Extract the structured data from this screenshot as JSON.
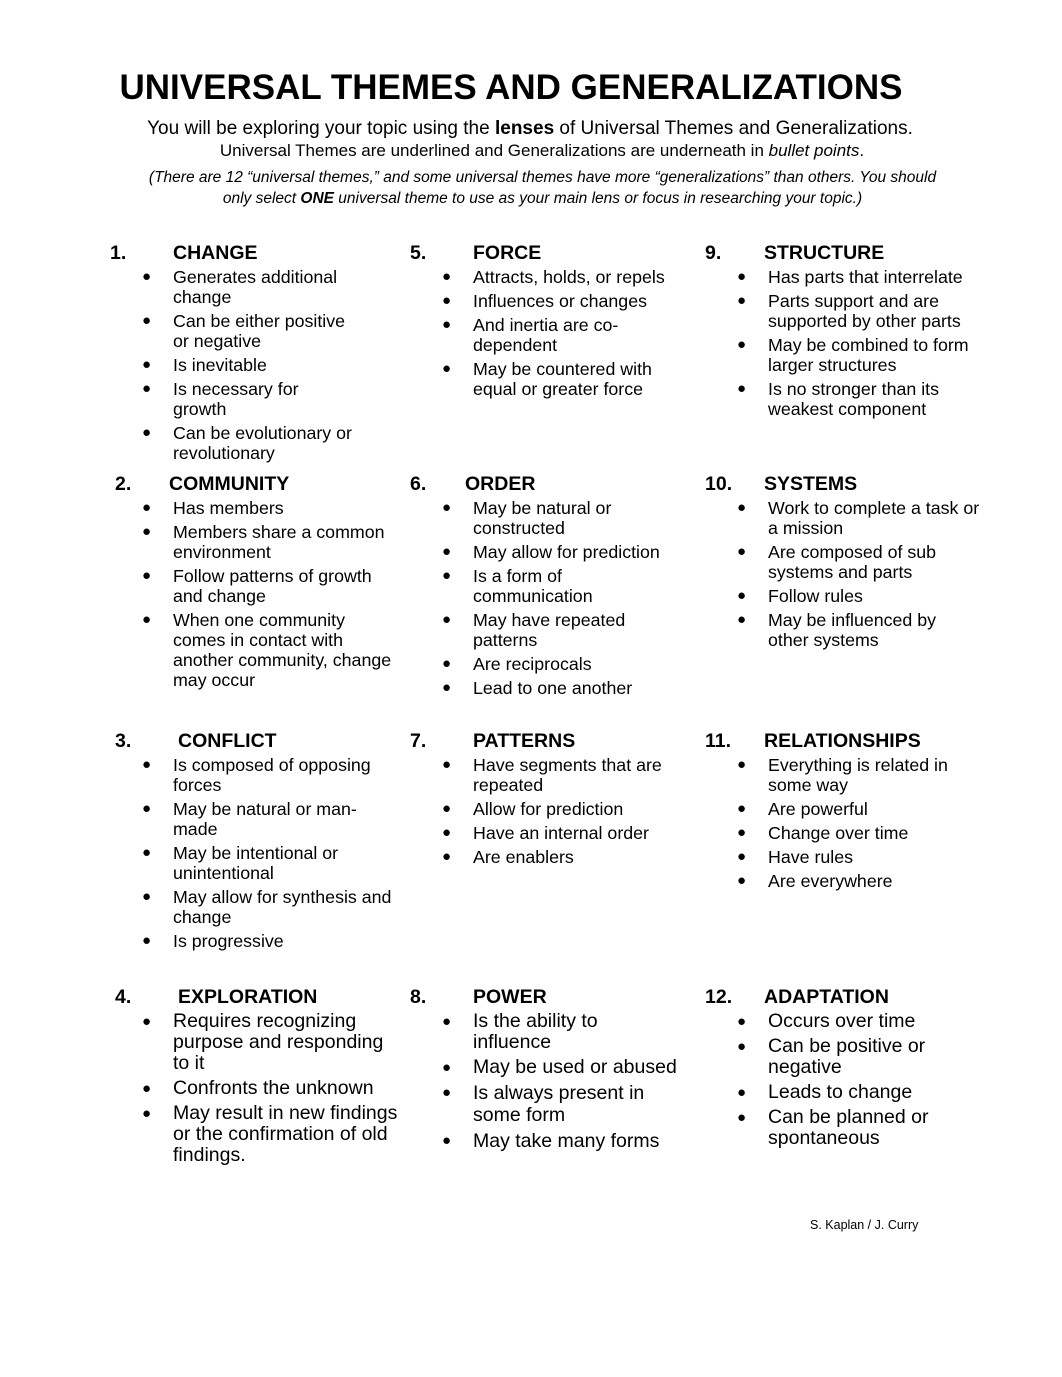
{
  "document": {
    "title": "UNIVERSAL THEMES AND GENERALIZATIONS",
    "intro": {
      "line1_before": "You will be exploring your topic using the ",
      "line1_bold": "lenses",
      "line1_after": " of Universal Themes and Generalizations.",
      "line2_before": "Universal Themes are underlined and Generalizations are underneath in ",
      "line2_italic": "bullet points",
      "line2_after": "."
    },
    "note": {
      "line1": "(There are 12 “universal themes,” and some universal themes have more “generalizations” than others. You should",
      "line2_before": "only select ",
      "line2_bold": "ONE",
      "line2_after": " universal theme to use as your main lens or focus in researching your topic.)"
    },
    "bullet_glyph": "●",
    "themes": [
      {
        "number": "1.",
        "name": "CHANGE",
        "generalizations": [
          "Generates additional change",
          "Can be either positive or negative",
          "Is inevitable",
          "Is necessary for growth",
          "Can be evolutionary or revolutionary"
        ]
      },
      {
        "number": "2.",
        "name": "COMMUNITY",
        "generalizations": [
          "Has members",
          "Members share a common environment",
          "Follow patterns of growth and change",
          "When one community comes in contact with another community, change may occur"
        ]
      },
      {
        "number": "3.",
        "name": "CONFLICT",
        "generalizations": [
          "Is composed of opposing forces",
          "May be natural or man-made",
          "May be intentional or unintentional",
          "May allow for synthesis and change",
          "Is progressive"
        ]
      },
      {
        "number": "4.",
        "name": "EXPLORATION",
        "generalizations": [
          "Requires recognizing purpose and responding to it",
          "Confronts the unknown",
          "May result in new findings or the confirmation of old findings."
        ]
      },
      {
        "number": "5.",
        "name": "FORCE",
        "generalizations": [
          "Attracts, holds, or repels",
          "Influences or changes",
          "And inertia are co-dependent",
          "May be countered with equal or greater force"
        ]
      },
      {
        "number": "6.",
        "name": "ORDER",
        "generalizations": [
          "May be natural or constructed",
          "May allow for prediction",
          "Is a form of communication",
          "May have repeated patterns",
          "Are reciprocals",
          "Lead to one another"
        ]
      },
      {
        "number": "7.",
        "name": "PATTERNS",
        "generalizations": [
          "Have segments that are repeated",
          "Allow for prediction",
          "Have an internal order",
          "Are enablers"
        ]
      },
      {
        "number": "8.",
        "name": "POWER",
        "generalizations": [
          "Is the ability to influence",
          "May be used or abused",
          "Is always present in some form",
          "May take many forms"
        ]
      },
      {
        "number": "9.",
        "name": "STRUCTURE",
        "generalizations": [
          "Has parts that interrelate",
          "Parts support and are supported by other parts",
          "May be combined to form larger structures",
          "Is no stronger than its weakest component"
        ]
      },
      {
        "number": "10.",
        "name": "SYSTEMS",
        "generalizations": [
          "Work to complete a task or a mission",
          "Are composed of sub systems and parts",
          "Follow rules",
          "May be influenced by other systems"
        ]
      },
      {
        "number": "11.",
        "name": "RELATIONSHIPS",
        "generalizations": [
          "Everything is related in some way",
          "Are powerful",
          "Change over time",
          "Have rules",
          "Are everywhere"
        ]
      },
      {
        "number": "12.",
        "name": "ADAPTATION",
        "generalizations": [
          "Occurs over time",
          "Can be positive or negative",
          "Leads to change",
          "Can be planned or spontaneous"
        ]
      }
    ],
    "credit": "S. Kaplan / J. Curry"
  }
}
